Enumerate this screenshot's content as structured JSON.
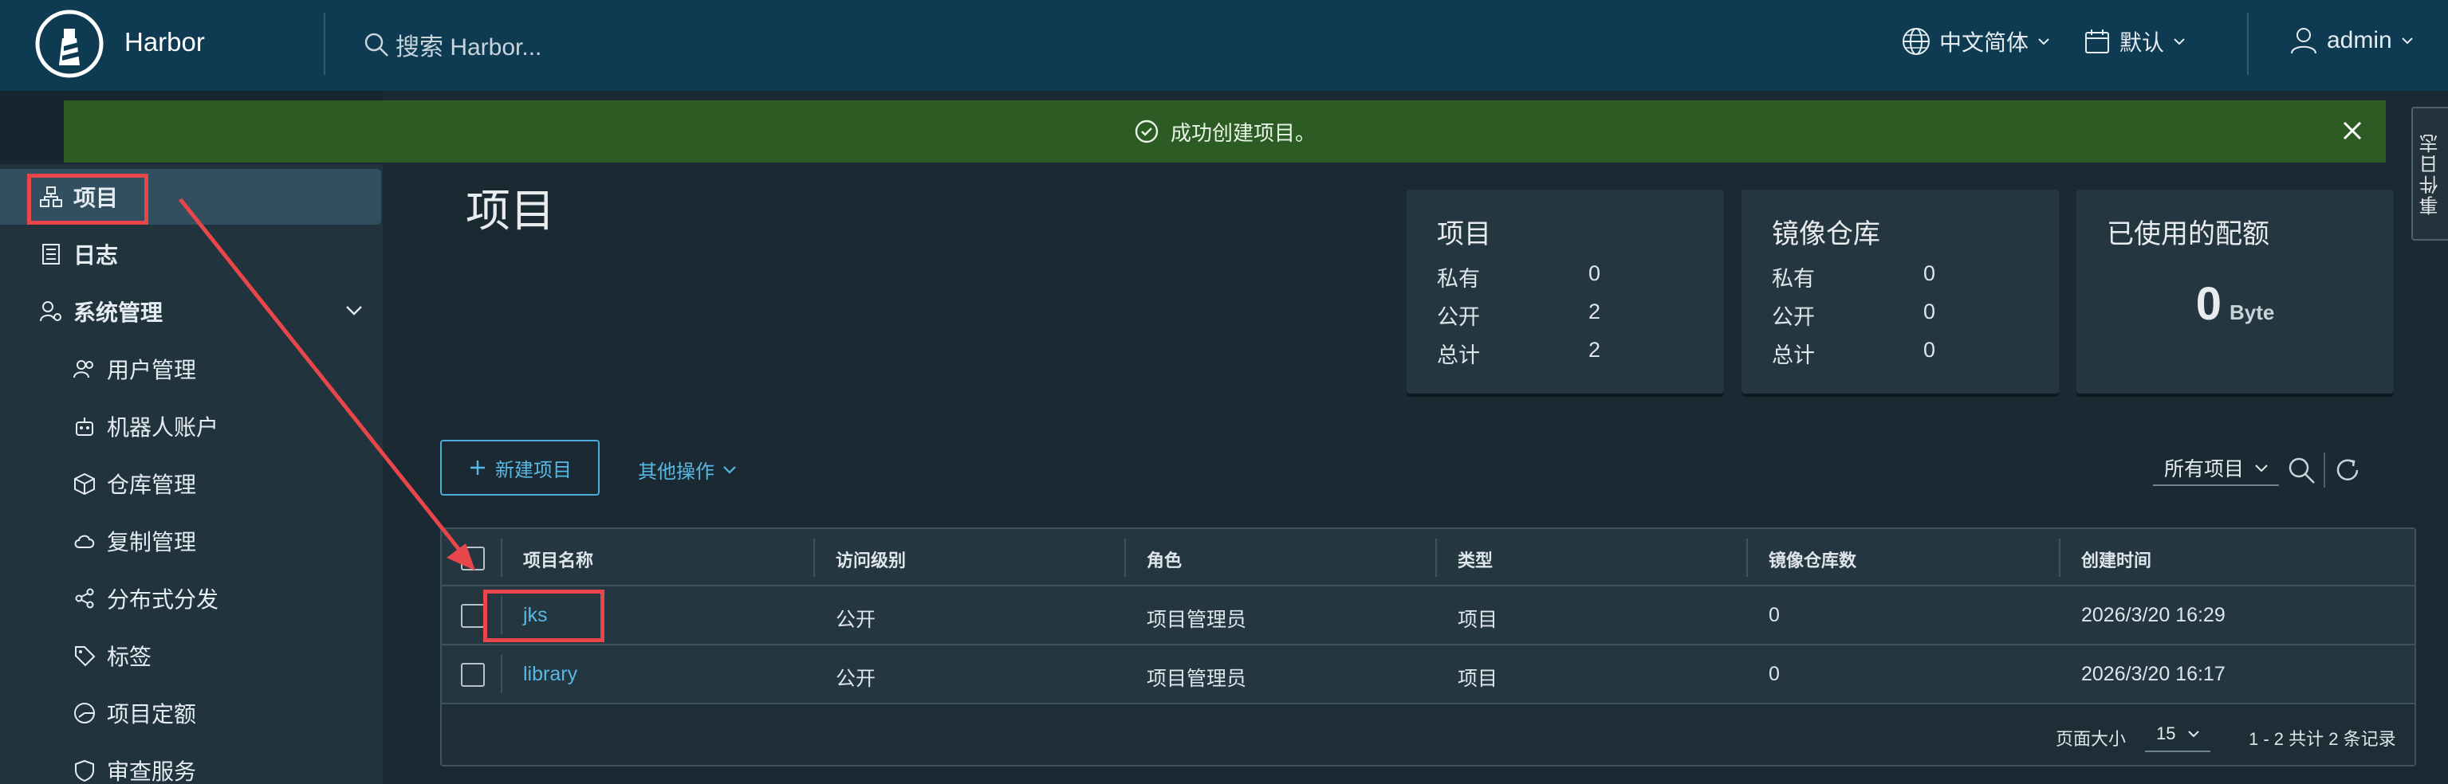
{
  "header": {
    "app_title": "Harbor",
    "search_placeholder": "搜索 Harbor...",
    "language": "中文简体",
    "theme": "默认",
    "user": "admin"
  },
  "sidebar": {
    "items": [
      {
        "label": "项目",
        "icon": "projects-icon",
        "active": true
      },
      {
        "label": "日志",
        "icon": "logs-icon"
      },
      {
        "label": "系统管理",
        "icon": "admin-icon",
        "expanded": true
      },
      {
        "label": "用户管理",
        "icon": "users-icon"
      },
      {
        "label": "机器人账户",
        "icon": "robot-icon"
      },
      {
        "label": "仓库管理",
        "icon": "registry-icon"
      },
      {
        "label": "复制管理",
        "icon": "cloud-icon"
      },
      {
        "label": "分布式分发",
        "icon": "share-icon"
      },
      {
        "label": "标签",
        "icon": "tag-icon"
      },
      {
        "label": "项目定额",
        "icon": "quota-icon"
      },
      {
        "label": "审查服务",
        "icon": "shield-icon"
      }
    ]
  },
  "alert": {
    "message": "成功创建项目。"
  },
  "event_log_tab": "事件日志",
  "page_title": "项目",
  "cards": {
    "projects": {
      "title": "项目",
      "rows": [
        {
          "label": "私有",
          "value": "0"
        },
        {
          "label": "公开",
          "value": "2"
        },
        {
          "label": "总计",
          "value": "2"
        }
      ]
    },
    "repos": {
      "title": "镜像仓库",
      "rows": [
        {
          "label": "私有",
          "value": "0"
        },
        {
          "label": "公开",
          "value": "0"
        },
        {
          "label": "总计",
          "value": "0"
        }
      ]
    },
    "quota": {
      "title": "已使用的配额",
      "value": "0",
      "unit": "Byte"
    }
  },
  "toolbar": {
    "new_project": "新建项目",
    "more_actions": "其他操作",
    "filter": "所有项目"
  },
  "table": {
    "columns": [
      "项目名称",
      "访问级别",
      "角色",
      "类型",
      "镜像仓库数",
      "创建时间"
    ],
    "rows": [
      [
        "jks",
        "公开",
        "项目管理员",
        "项目",
        "0",
        "2026/3/20 16:29"
      ],
      [
        "library",
        "公开",
        "项目管理员",
        "项目",
        "0",
        "2026/3/20 16:17"
      ]
    ]
  },
  "pagination": {
    "page_size_label": "页面大小",
    "page_size": "15",
    "summary": "1 - 2 共计 2 条记录"
  },
  "colors": {
    "header": "#0e3a52",
    "alert": "#2d5b24",
    "link": "#57b8e6",
    "highlight": "#e8464a"
  }
}
